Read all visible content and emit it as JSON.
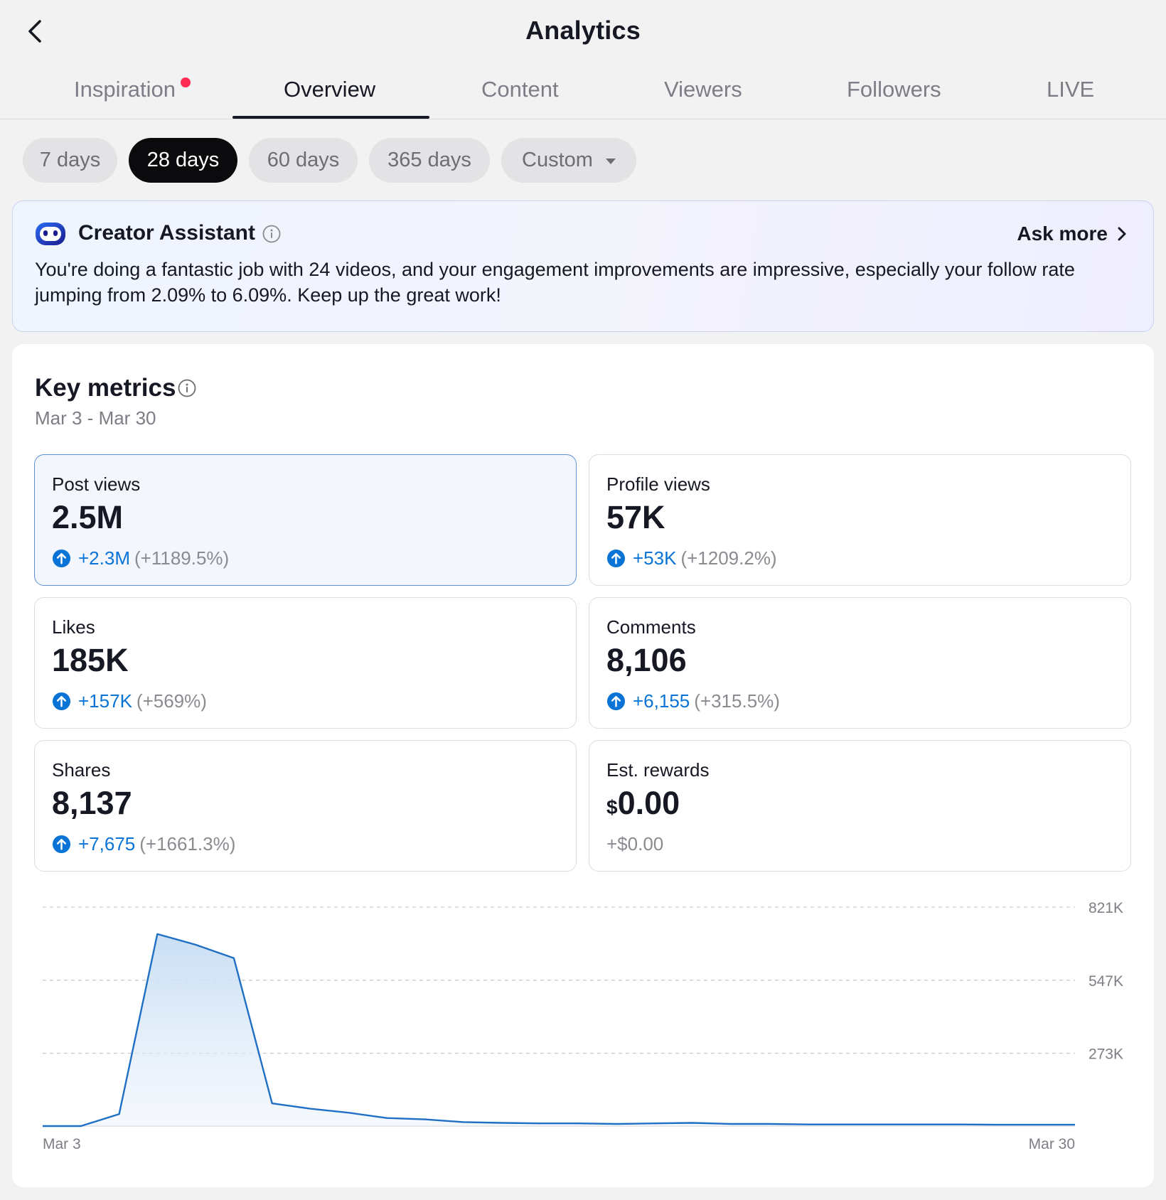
{
  "header": {
    "title": "Analytics",
    "back_icon": "chevron-left-icon"
  },
  "tabs": [
    {
      "label": "Inspiration",
      "notification_dot": true
    },
    {
      "label": "Overview",
      "active": true
    },
    {
      "label": "Content"
    },
    {
      "label": "Viewers"
    },
    {
      "label": "Followers"
    },
    {
      "label": "LIVE"
    }
  ],
  "ranges": [
    {
      "label": "7 days"
    },
    {
      "label": "28 days",
      "selected": true
    },
    {
      "label": "60 days"
    },
    {
      "label": "365 days"
    },
    {
      "label": "Custom",
      "has_dropdown": true
    }
  ],
  "assistant": {
    "title": "Creator Assistant",
    "ask_more": "Ask more",
    "message": "You're doing a fantastic job with 24 videos, and your engagement improvements are impressive, especially your follow rate jumping from 2.09% to 6.09%. Keep up the great work!"
  },
  "key_metrics": {
    "title": "Key metrics",
    "date_range": "Mar 3 - Mar 30",
    "cards": [
      {
        "label": "Post views",
        "value": "2.5M",
        "delta": "+2.3M",
        "delta_pct": "(+1189.5%)",
        "selected": true
      },
      {
        "label": "Profile views",
        "value": "57K",
        "delta": "+53K",
        "delta_pct": "(+1209.2%)"
      },
      {
        "label": "Likes",
        "value": "185K",
        "delta": "+157K",
        "delta_pct": "(+569%)"
      },
      {
        "label": "Comments",
        "value": "8,106",
        "delta": "+6,155",
        "delta_pct": "(+315.5%)"
      },
      {
        "label": "Shares",
        "value": "8,137",
        "delta": "+7,675",
        "delta_pct": "(+1661.3%)"
      },
      {
        "label": "Est. rewards",
        "currency": "$",
        "value": "0.00",
        "delta_plain": "+$0.00"
      }
    ]
  },
  "colors": {
    "accent_blue": "#0a73d6",
    "notification_red": "#fe2c55",
    "chart_line": "#1f6fc5",
    "chart_fill": "#cfe2f6"
  },
  "chart_data": {
    "type": "area",
    "x_labels": [
      "Mar 3",
      "Mar 30"
    ],
    "ytick_labels": [
      "821K",
      "547K",
      "273K"
    ],
    "ytick_values": [
      821000,
      547000,
      273000
    ],
    "ylim": [
      0,
      821000
    ],
    "grid": true,
    "series": [
      {
        "values": [
          0,
          0,
          45000,
          720000,
          680000,
          630000,
          85000,
          65000,
          50000,
          30000,
          25000,
          15000,
          12000,
          10000,
          10000,
          8000,
          10000,
          12000,
          8000,
          8000,
          6000,
          6000,
          6000,
          6000,
          6000,
          5000,
          5000,
          5000
        ]
      }
    ]
  }
}
